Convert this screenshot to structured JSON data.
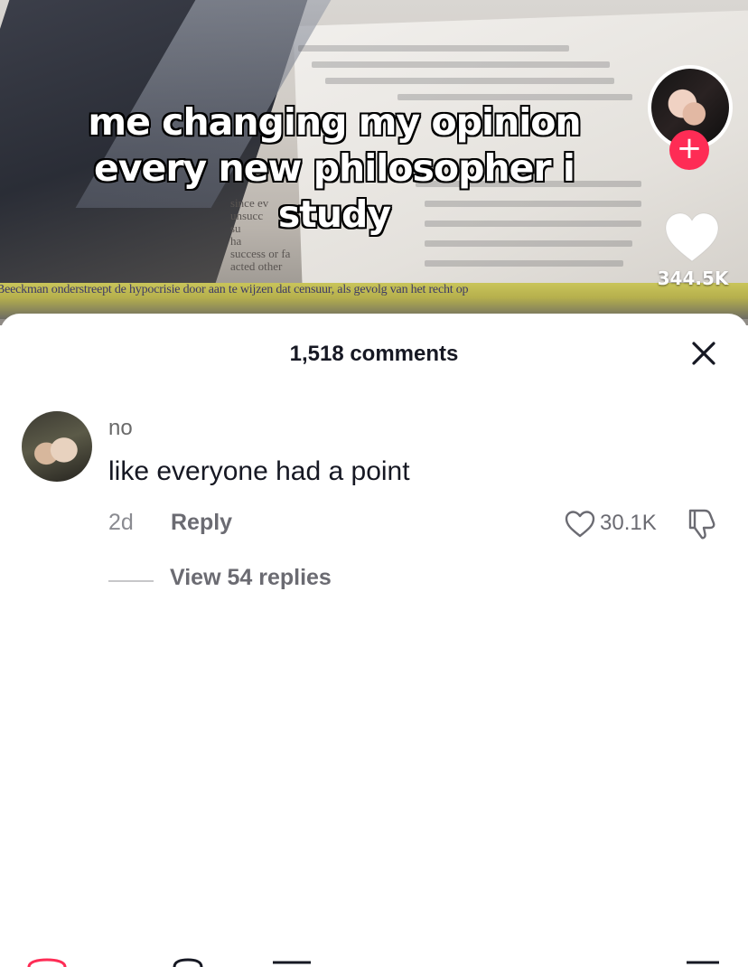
{
  "video": {
    "caption_line1": "me changing my opinion",
    "caption_line2": "every new philosopher i",
    "caption_line3": "study",
    "book_lines": [
      "since ev",
      "unsucc",
      "su",
      "ha",
      "success or fa",
      "acted other"
    ],
    "strip_text": "Beeckman onderstreept de hypocrisie door aan te wijzen dat censuur, als gevolg van het recht op",
    "like_count": "344.5K",
    "follow_icon": "plus-icon",
    "like_icon": "heart-icon"
  },
  "comments": {
    "title": "1,518 comments",
    "close_icon": "close-icon",
    "items": [
      {
        "username": "no",
        "text": "like everyone had a point",
        "time": "2d",
        "reply_label": "Reply",
        "like_count": "30.1K",
        "view_replies": "View 54 replies"
      }
    ]
  },
  "colors": {
    "accent": "#fe2c55",
    "text_primary": "#161823",
    "text_secondary": "#8a8b91"
  }
}
